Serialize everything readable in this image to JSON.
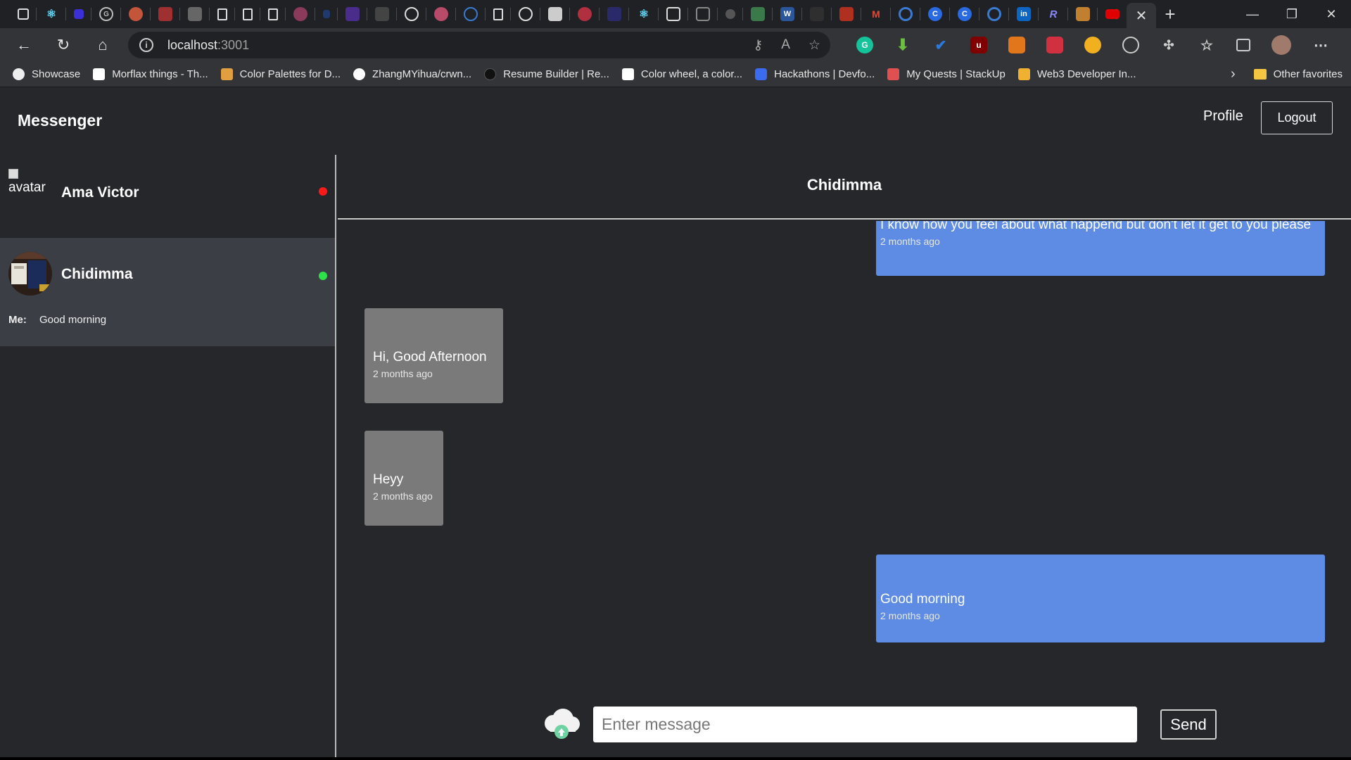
{
  "browser": {
    "tab_close": "✕",
    "new_tab": "+",
    "window_controls": [
      "—",
      "❐",
      "✕"
    ],
    "url_host": "localhost",
    "url_port": ":3001",
    "bookmarks": [
      {
        "label": "Showcase",
        "color": "#f2f2f2"
      },
      {
        "label": "Morflax things - Th...",
        "color": "#ffffff"
      },
      {
        "label": "Color Palettes for D...",
        "color": "#e0a040"
      },
      {
        "label": "ZhangMYihua/crwn...",
        "color": "#ffffff"
      },
      {
        "label": "Resume Builder | Re...",
        "color": "#111111"
      },
      {
        "label": "Color wheel, a color...",
        "color": "#ffffff"
      },
      {
        "label": "Hackathons | Devfo...",
        "color": "#3b6cf0"
      },
      {
        "label": "My Quests | StackUp",
        "color": "#e05050"
      },
      {
        "label": "Web3 Developer In...",
        "color": "#f0b030"
      }
    ],
    "other_favorites": "Other favorites"
  },
  "app": {
    "brand": "Messenger",
    "profile_label": "Profile",
    "logout_label": "Logout"
  },
  "contacts": [
    {
      "name": "Ama Victor",
      "avatar_alt": "avatar",
      "status_color": "#ff1a1a"
    },
    {
      "name": "Chidimma",
      "status_color": "#2ee04a",
      "last_prefix": "Me:",
      "last_message": "Good morning"
    }
  ],
  "chat": {
    "title": "Chidimma",
    "messages": [
      {
        "type": "sent",
        "text": "I know how you feel about what happend but don't let it get to you please",
        "time": "2 months ago"
      },
      {
        "type": "recv",
        "text": "Hi, Good Afternoon",
        "time": "2 months ago"
      },
      {
        "type": "recv",
        "text": "Heyy",
        "time": "2 months ago"
      },
      {
        "type": "sent",
        "text": "Good morning",
        "time": "2 months ago"
      }
    ],
    "input_placeholder": "Enter message",
    "send_label": "Send"
  },
  "colors": {
    "sent_bubble": "#5e8ce4",
    "recv_bubble": "#7a7a7a",
    "background": "#25272b"
  }
}
